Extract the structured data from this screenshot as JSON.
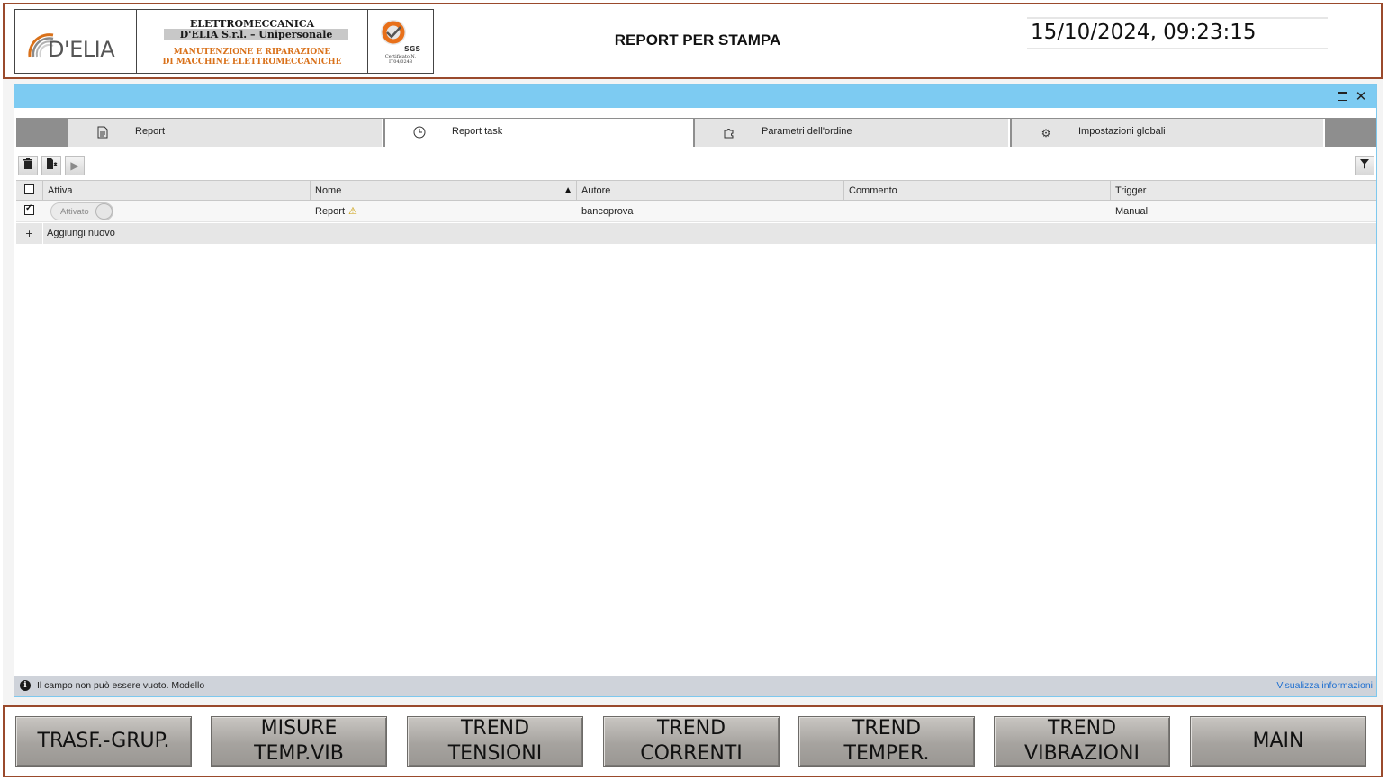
{
  "header": {
    "logo": {
      "brand": "D'ELIA",
      "company_line1": "ELETTROMECCANICA",
      "company_line2": "D'ELIA S.r.l. – Unipersonale",
      "company_line3": "MANUTENZIONE E RIPARAZIONE",
      "company_line4": "DI MACCHINE ELETTROMECCANICHE",
      "cert_badge": "SGS",
      "cert_text_line1": "Certificato N.",
      "cert_text_line2": "IT04/0248"
    },
    "title": "REPORT PER STAMPA",
    "datetime": "15/10/2024, 09:23:15"
  },
  "window": {
    "tabs": [
      {
        "label": "Report",
        "icon": "document-icon",
        "active": false
      },
      {
        "label": "Report task",
        "icon": "clock-icon",
        "active": true
      },
      {
        "label": "Parametri dell'ordine",
        "icon": "puzzle-icon",
        "active": false
      },
      {
        "label": "Impostazioni globali",
        "icon": "gear-icon",
        "active": false
      }
    ],
    "toolbar": {
      "delete_icon": "trash-icon",
      "new_icon": "new-document-icon",
      "run_icon": "play-icon",
      "filter_icon": "filter-icon"
    },
    "grid": {
      "columns": [
        "Attiva",
        "Nome",
        "Autore",
        "Commento",
        "Trigger"
      ],
      "sort_column": "Nome",
      "rows": [
        {
          "selected": true,
          "toggle_label": "Attivato",
          "name": "Report",
          "warning": true,
          "author": "bancoprova",
          "comment": "",
          "trigger": "Manual"
        }
      ],
      "add_row": {
        "icon": "+",
        "label": "Aggiungi nuovo"
      }
    },
    "status": {
      "icon": "info-icon",
      "text": "Il campo non può essere vuoto. Modello",
      "link": "Visualizza informazioni"
    }
  },
  "nav": {
    "buttons": [
      {
        "line1": "TRASF.-GRUP.",
        "line2": ""
      },
      {
        "line1": "MISURE",
        "line2": "TEMP.VIB"
      },
      {
        "line1": "TREND",
        "line2": "TENSIONI"
      },
      {
        "line1": "TREND",
        "line2": "CORRENTI"
      },
      {
        "line1": "TREND",
        "line2": "TEMPER."
      },
      {
        "line1": "TREND",
        "line2": "VIBRAZIONI"
      },
      {
        "line1": "MAIN",
        "line2": ""
      }
    ]
  },
  "colors": {
    "frame_border": "#9a4a2c",
    "titlebar": "#7dcbf2",
    "link": "#1e6fd0",
    "accent_orange": "#d9711a"
  }
}
